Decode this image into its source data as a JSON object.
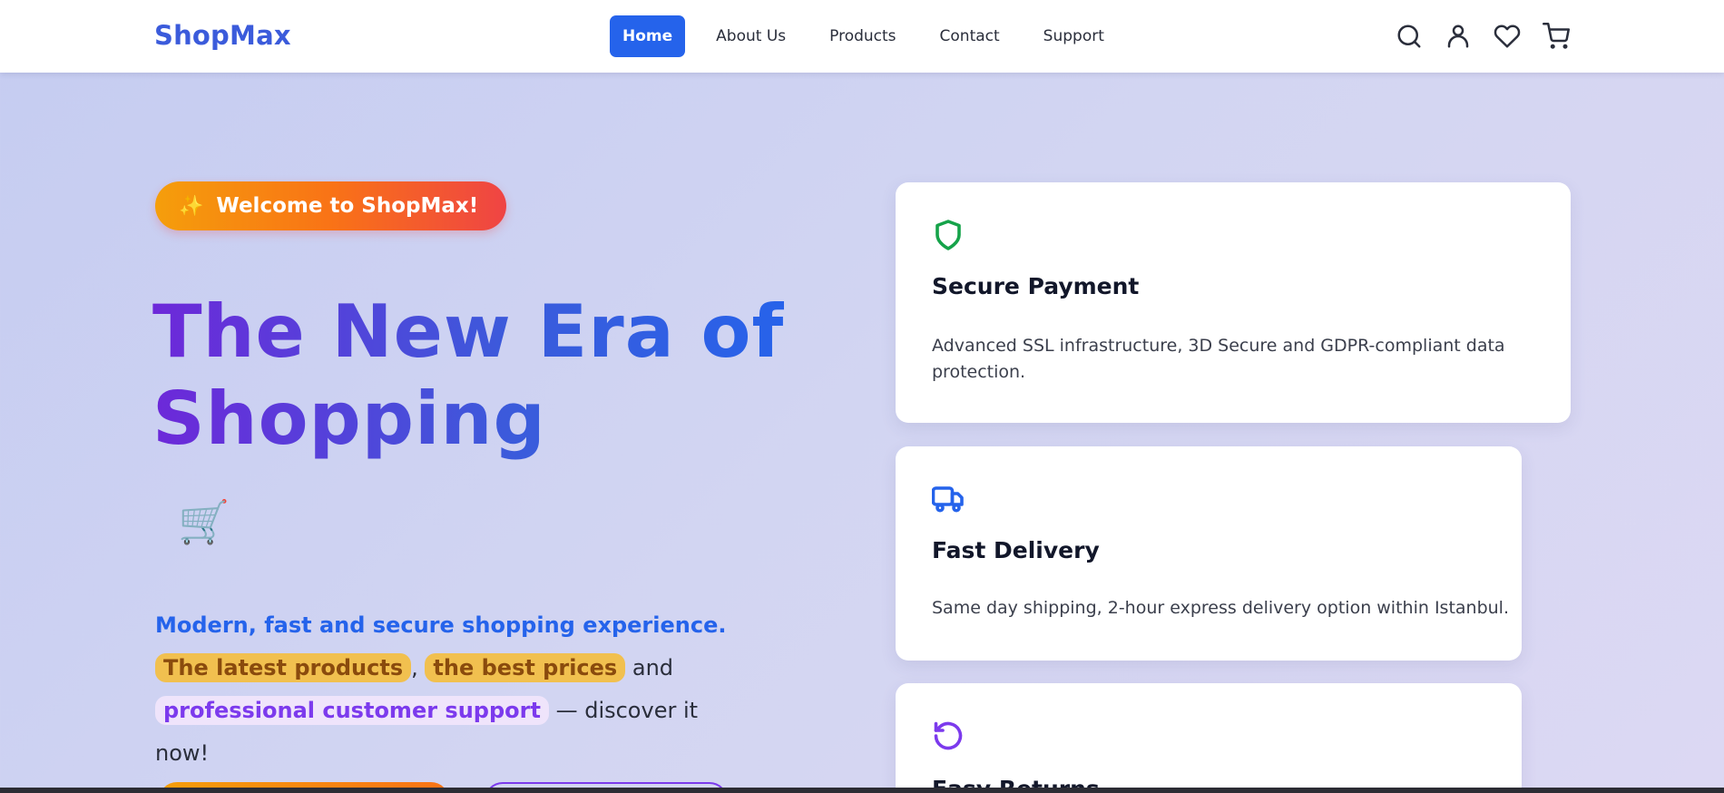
{
  "header": {
    "brand": "ShopMax",
    "nav": [
      {
        "label": "Home",
        "active": true
      },
      {
        "label": "About Us",
        "active": false
      },
      {
        "label": "Products",
        "active": false
      },
      {
        "label": "Contact",
        "active": false
      },
      {
        "label": "Support",
        "active": false
      }
    ],
    "icons": [
      "search-icon",
      "user-icon",
      "heart-icon",
      "cart-icon"
    ]
  },
  "hero": {
    "badge_icon": "sparkle-icon",
    "badge": "Welcome to ShopMax!",
    "headline_line1": "The New Era of",
    "headline_line2": "Shopping",
    "emoji": "🛒",
    "lead_intro": "Modern, fast and secure shopping experience.",
    "lead_hl1": "The latest products",
    "lead_sep1": ",",
    "lead_hl2": "the best prices",
    "lead_sep2": "and",
    "lead_hl3": "professional customer support",
    "lead_outro": "— discover it now!"
  },
  "features": [
    {
      "icon": "shield-icon",
      "icon_color": "#16a34a",
      "title": "Secure Payment",
      "description": "Advanced SSL infrastructure, 3D Secure and GDPR-compliant data protection."
    },
    {
      "icon": "truck-icon",
      "icon_color": "#2563eb",
      "title": "Fast Delivery",
      "description": "Same day shipping, 2-hour express delivery option within Istanbul."
    },
    {
      "icon": "return-icon",
      "icon_color": "#7c3aed",
      "title": "Easy Returns",
      "description": ""
    }
  ],
  "colors": {
    "accent": "#2563eb",
    "brand": "#3b5bdb",
    "highlight_yellow": "#f1c04f",
    "highlight_purple": "#efe4fb"
  }
}
